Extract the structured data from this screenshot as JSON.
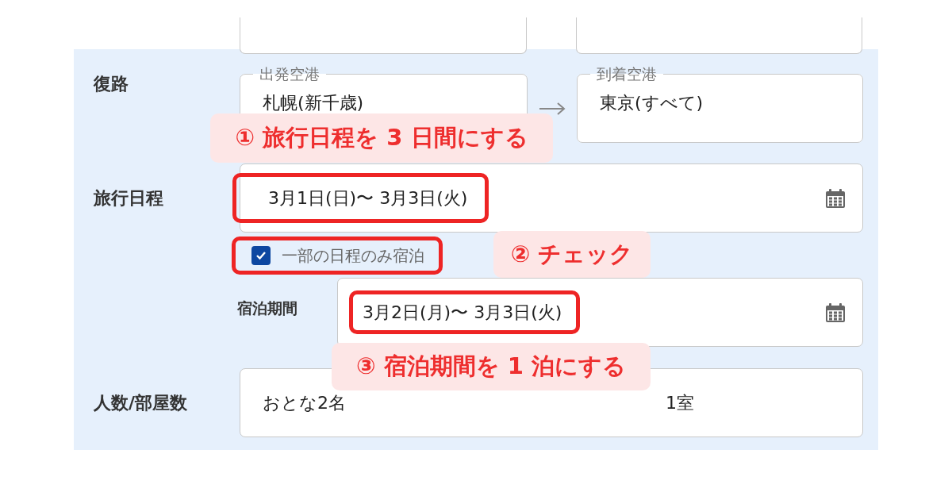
{
  "return_route": {
    "label": "復路",
    "departure": {
      "label": "出発空港",
      "value": "札幌(新千歳)"
    },
    "arrival": {
      "label": "到着空港",
      "value": "東京(すべて)"
    }
  },
  "travel_dates": {
    "label": "旅行日程",
    "value": "3月1日(日)〜 3月3日(火)",
    "highlighted": true
  },
  "partial_stay": {
    "label": "一部の日程のみ宿泊",
    "checked": true,
    "highlighted": true
  },
  "stay_period": {
    "label": "宿泊期間",
    "value": "3月2日(月)〜 3月3日(火)",
    "highlighted": true
  },
  "guests": {
    "label": "人数/部屋数",
    "adults": "おとな2名",
    "rooms": "1室"
  },
  "callouts": [
    {
      "text": "① 旅行日程を 3 日間にする"
    },
    {
      "text": "② チェック"
    },
    {
      "text": "③ 宿泊期間を 1 泊にする"
    }
  ]
}
